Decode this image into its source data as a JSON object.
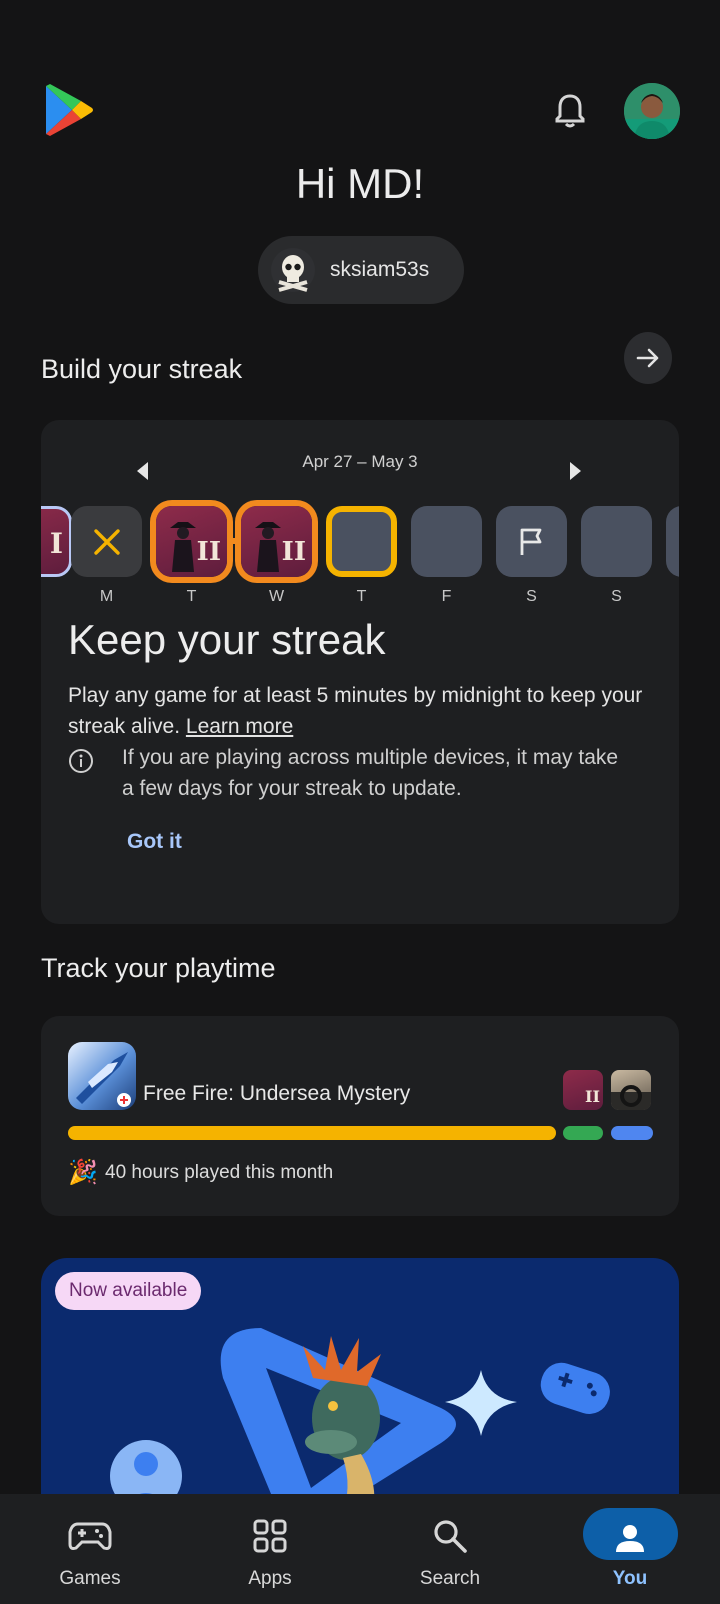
{
  "header": {
    "greeting": "Hi MD!",
    "gamer_tag": "sksiam53s",
    "icons": [
      "play-store-logo-icon",
      "bell-icon",
      "profile-avatar"
    ]
  },
  "streak": {
    "section_title": "Build your streak",
    "week_range": "Apr 27 – May 3",
    "days": [
      {
        "letter": "M",
        "state": "missed"
      },
      {
        "letter": "T",
        "state": "played"
      },
      {
        "letter": "W",
        "state": "played"
      },
      {
        "letter": "T",
        "state": "today"
      },
      {
        "letter": "F",
        "state": "upcoming"
      },
      {
        "letter": "S",
        "state": "goal"
      },
      {
        "letter": "S",
        "state": "upcoming"
      }
    ],
    "title": "Keep your streak",
    "body": "Play any game for at least 5 minutes by midnight to keep your streak alive.",
    "learn_more": "Learn more",
    "info": "If you are playing across multiple devices, it may take a few days for your streak to update.",
    "got_it": "Got it"
  },
  "playtime": {
    "section_title": "Track your playtime",
    "top_game": "Free Fire: Undersea Mystery",
    "summary": "40 hours played this month",
    "colors": {
      "top": "#f5b300",
      "second": "#34a853",
      "third": "#4f86f0"
    }
  },
  "banner": {
    "badge": "Now available"
  },
  "nav": {
    "games": "Games",
    "apps": "Apps",
    "search": "Search",
    "you": "You"
  },
  "colors": {
    "accent": "#a8c7fa",
    "streak_today": "#f5b300",
    "streak_played": "#f28a1e",
    "background": "#141415"
  }
}
